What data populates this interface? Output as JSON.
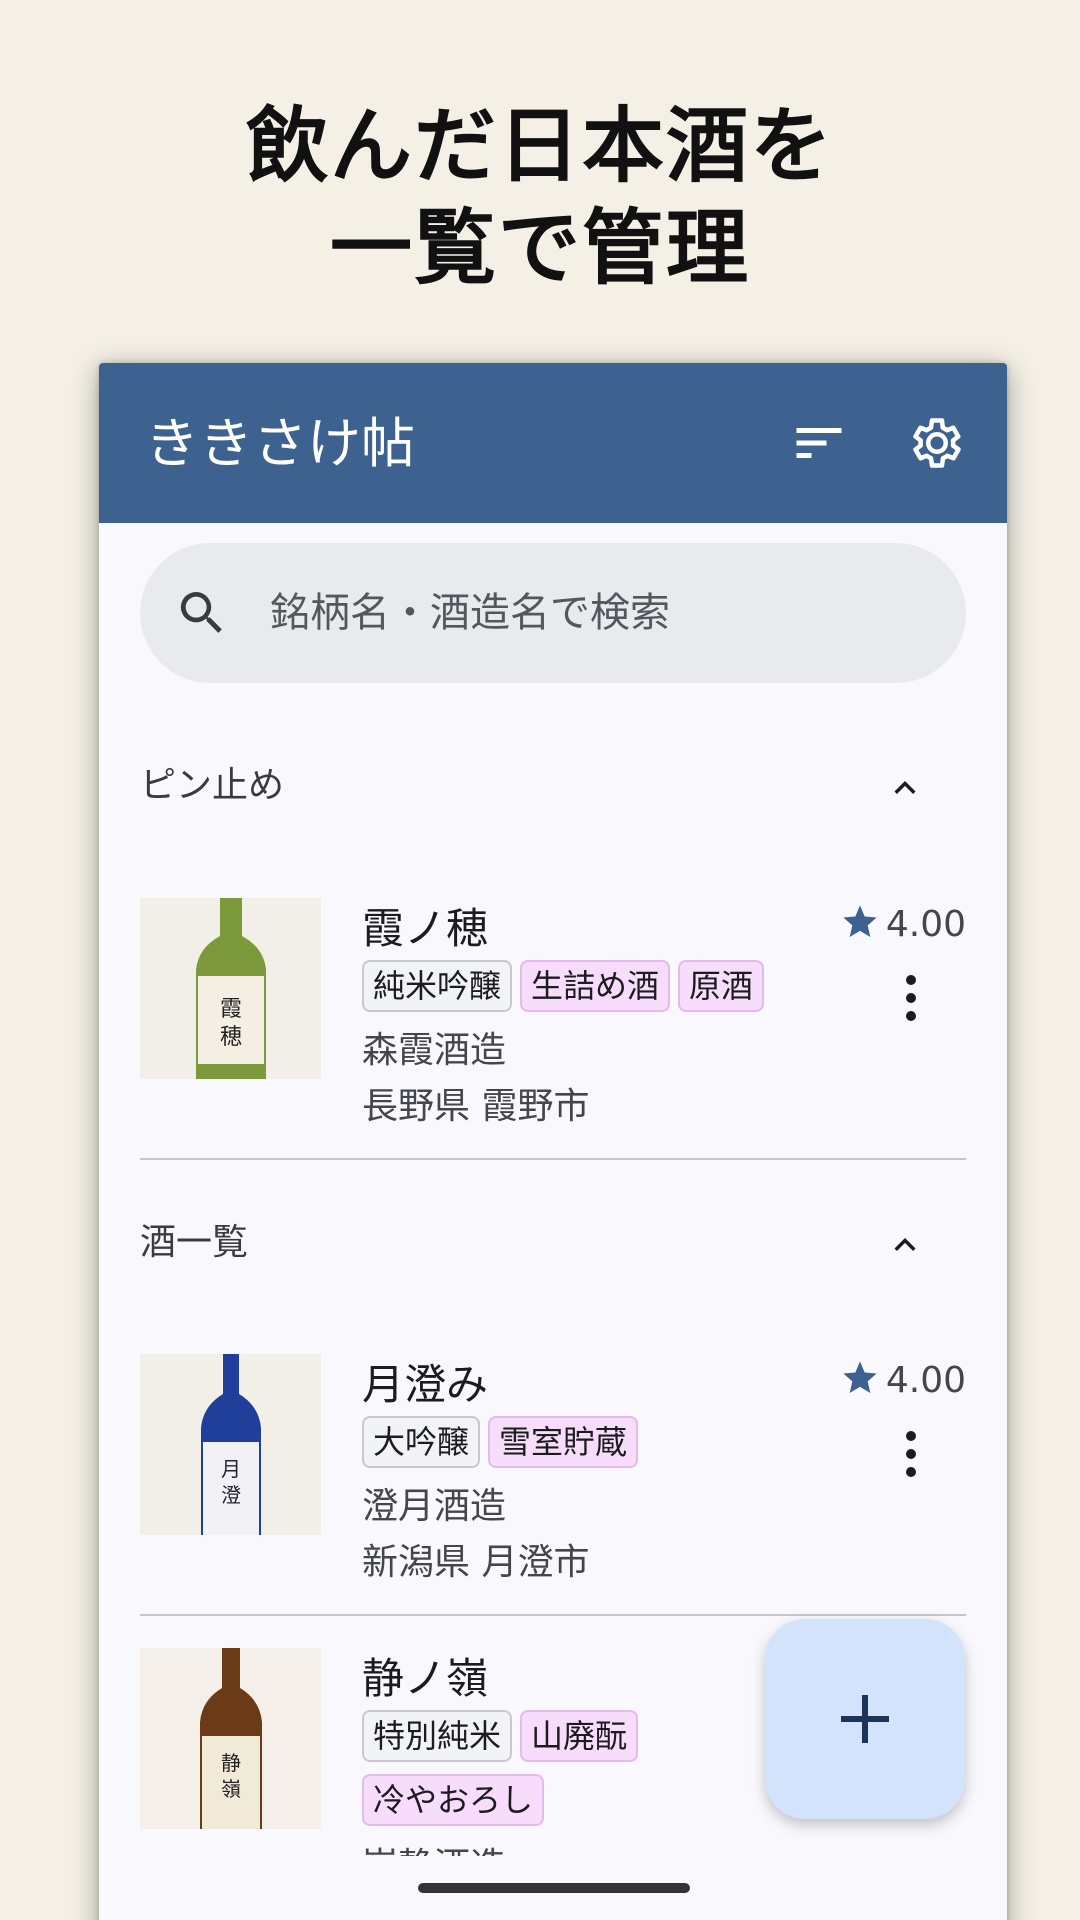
{
  "hero": {
    "line1": "飲んだ日本酒を",
    "line2": "一覧で管理"
  },
  "appbar": {
    "title": "ききさけ帖",
    "sort_icon": "sort-icon",
    "settings_icon": "gear-icon"
  },
  "search": {
    "placeholder": "銘柄名・酒造名で検索",
    "icon": "search-icon"
  },
  "sections": [
    {
      "title": "ピン止め",
      "icon": "chevron-up-icon"
    },
    {
      "title": "酒一覧",
      "icon": "chevron-up-icon"
    }
  ],
  "pinned": [
    {
      "name": "霞ノ穂",
      "tags": [
        {
          "label": "純米吟醸",
          "kind": "grade"
        },
        {
          "label": "生詰め酒",
          "kind": "feature"
        },
        {
          "label": "原酒",
          "kind": "feature"
        }
      ],
      "brewery": "森霞酒造",
      "location": "長野県 霞野市",
      "rating": "4.00",
      "bottle_color": "#7c9a3c",
      "label_text": "霞ノ穂"
    }
  ],
  "list": [
    {
      "name": "月澄み",
      "tags": [
        {
          "label": "大吟醸",
          "kind": "grade"
        },
        {
          "label": "雪室貯蔵",
          "kind": "feature"
        }
      ],
      "brewery": "澄月酒造",
      "location": "新潟県 月澄市",
      "rating": "4.00",
      "bottle_color": "#1f3f9a",
      "label_text": "月澄み"
    },
    {
      "name": "静ノ嶺",
      "tags": [
        {
          "label": "特別純米",
          "kind": "grade"
        },
        {
          "label": "山廃酛",
          "kind": "feature"
        },
        {
          "label": "冷やおろし",
          "kind": "feature"
        }
      ],
      "brewery": "嶺静酒造",
      "label_text": "静ノ嶺",
      "bottle_color": "#6b3a16"
    }
  ],
  "colors": {
    "appbar": "#3e6290",
    "star": "#3e6290",
    "tag_feature": "#f7dcfb",
    "fab": "#d3e3fb"
  },
  "fab": {
    "icon": "plus-icon"
  }
}
